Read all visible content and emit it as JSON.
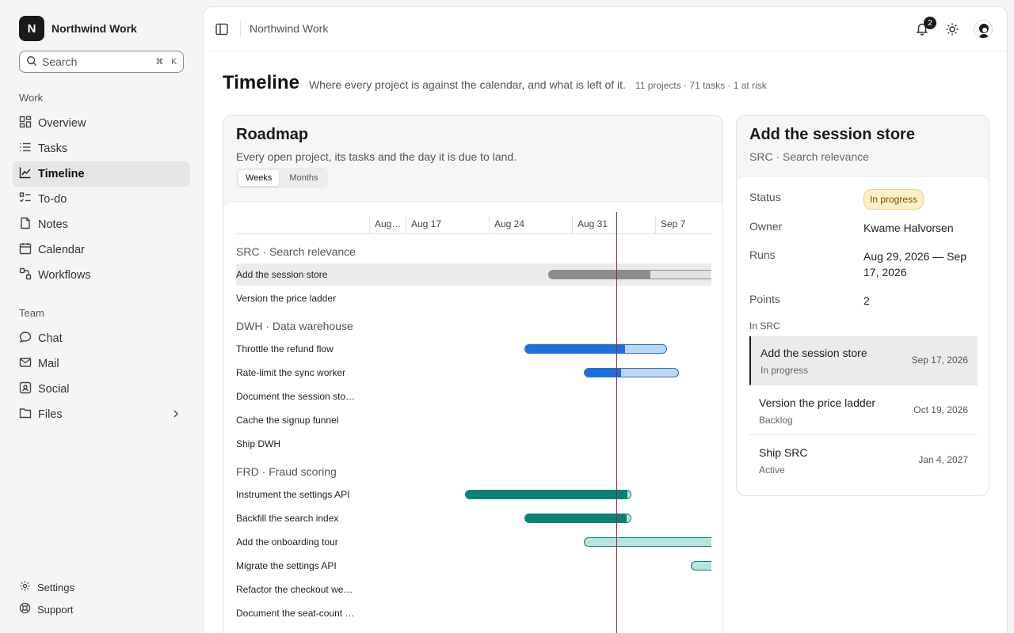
{
  "brand": {
    "logo": "N",
    "name": "Northwind Work"
  },
  "search": {
    "placeholder": "Search",
    "kbd1": "⌘",
    "kbd2": "K"
  },
  "sidebar": {
    "work_label": "Work",
    "work_items": [
      {
        "label": "Overview",
        "icon": "grid-icon"
      },
      {
        "label": "Tasks",
        "icon": "list-icon"
      },
      {
        "label": "Timeline",
        "icon": "chart-line-icon",
        "active": true
      },
      {
        "label": "To-do",
        "icon": "checklist-icon"
      },
      {
        "label": "Notes",
        "icon": "note-icon"
      },
      {
        "label": "Calendar",
        "icon": "calendar-icon"
      },
      {
        "label": "Workflows",
        "icon": "workflow-icon"
      }
    ],
    "team_label": "Team",
    "team_items": [
      {
        "label": "Chat",
        "icon": "chat-icon"
      },
      {
        "label": "Mail",
        "icon": "mail-icon"
      },
      {
        "label": "Social",
        "icon": "social-icon"
      },
      {
        "label": "Files",
        "icon": "folder-icon"
      }
    ],
    "footer": [
      {
        "label": "Settings",
        "icon": "gear-icon"
      },
      {
        "label": "Support",
        "icon": "lifebuoy-icon"
      }
    ]
  },
  "topbar": {
    "breadcrumb": "Northwind Work",
    "notification_count": "2"
  },
  "page": {
    "title": "Timeline",
    "subtitle": "Where every project is against the calendar, and what is left of it.",
    "stats": "11 projects · 71 tasks · 1 at risk"
  },
  "roadmap": {
    "title": "Roadmap",
    "subtitle": "Every open project, its tasks and the day it is due to land.",
    "views": [
      "Weeks",
      "Months"
    ],
    "active_view": "Weeks",
    "axis_ticks": [
      "Aug…",
      "Aug 17",
      "Aug 24",
      "Aug 31",
      "Sep 7"
    ],
    "groups": [
      {
        "label": "SRC · Search relevance",
        "rows": [
          {
            "name": "Add the session store",
            "selected": true,
            "color": "#8c8c8c",
            "track": "#e2e2e2",
            "start": "2026-08-29",
            "end": "2026-09-17",
            "progress": 0.45
          },
          {
            "name": "Version the price ladder"
          }
        ]
      },
      {
        "label": "DWH · Data warehouse",
        "rows": [
          {
            "name": "Throttle the refund flow",
            "color": "#1f6fdb",
            "track": "#bcd6f6",
            "start": "2026-08-27",
            "end": "2026-09-08",
            "progress": 0.7
          },
          {
            "name": "Rate-limit the sync worker",
            "color": "#1f6fdb",
            "track": "#bcd6f6",
            "start": "2026-09-01",
            "end": "2026-09-09",
            "progress": 0.38
          },
          {
            "name": "Document the session sto…"
          },
          {
            "name": "Cache the signup funnel"
          },
          {
            "name": "Ship DWH"
          }
        ]
      },
      {
        "label": "FRD · Fraud scoring",
        "rows": [
          {
            "name": "Instrument the settings API",
            "color": "#0a8275",
            "track": "#b8e4de",
            "start": "2026-08-22",
            "end": "2026-09-05",
            "progress": 0.97
          },
          {
            "name": "Backfill the search index",
            "color": "#0a8275",
            "track": "#b8e4de",
            "start": "2026-08-27",
            "end": "2026-09-05",
            "progress": 0.95
          },
          {
            "name": "Add the onboarding tour",
            "color": "#0a8275",
            "track": "#b8e4de",
            "start": "2026-09-01",
            "end": "2026-09-20",
            "progress": 0
          },
          {
            "name": "Migrate the settings API",
            "color": "#0a8275",
            "track": "#b8e4de",
            "start": "2026-09-10",
            "end": "2026-09-25",
            "progress": 0
          },
          {
            "name": "Refactor the checkout we…"
          },
          {
            "name": "Document the seat-count …"
          }
        ]
      }
    ]
  },
  "detail": {
    "title": "Add the session store",
    "subtitle": "SRC · Search relevance",
    "fields": [
      {
        "key": "Status",
        "value": "In progress"
      },
      {
        "key": "Owner",
        "value": "Kwame Halvorsen"
      },
      {
        "key": "Runs",
        "value": "Aug 29, 2026 — Sep 17, 2026"
      },
      {
        "key": "Points",
        "value": "2"
      }
    ],
    "in_label": "In SRC",
    "tasks": [
      {
        "name": "Add the session store",
        "status": "In progress",
        "date": "Sep 17, 2026",
        "selected": true
      },
      {
        "name": "Version the price ladder",
        "status": "Backlog",
        "date": "Oct 19, 2026"
      },
      {
        "name": "Ship SRC",
        "status": "Active",
        "date": "Jan 4, 2027"
      }
    ]
  }
}
